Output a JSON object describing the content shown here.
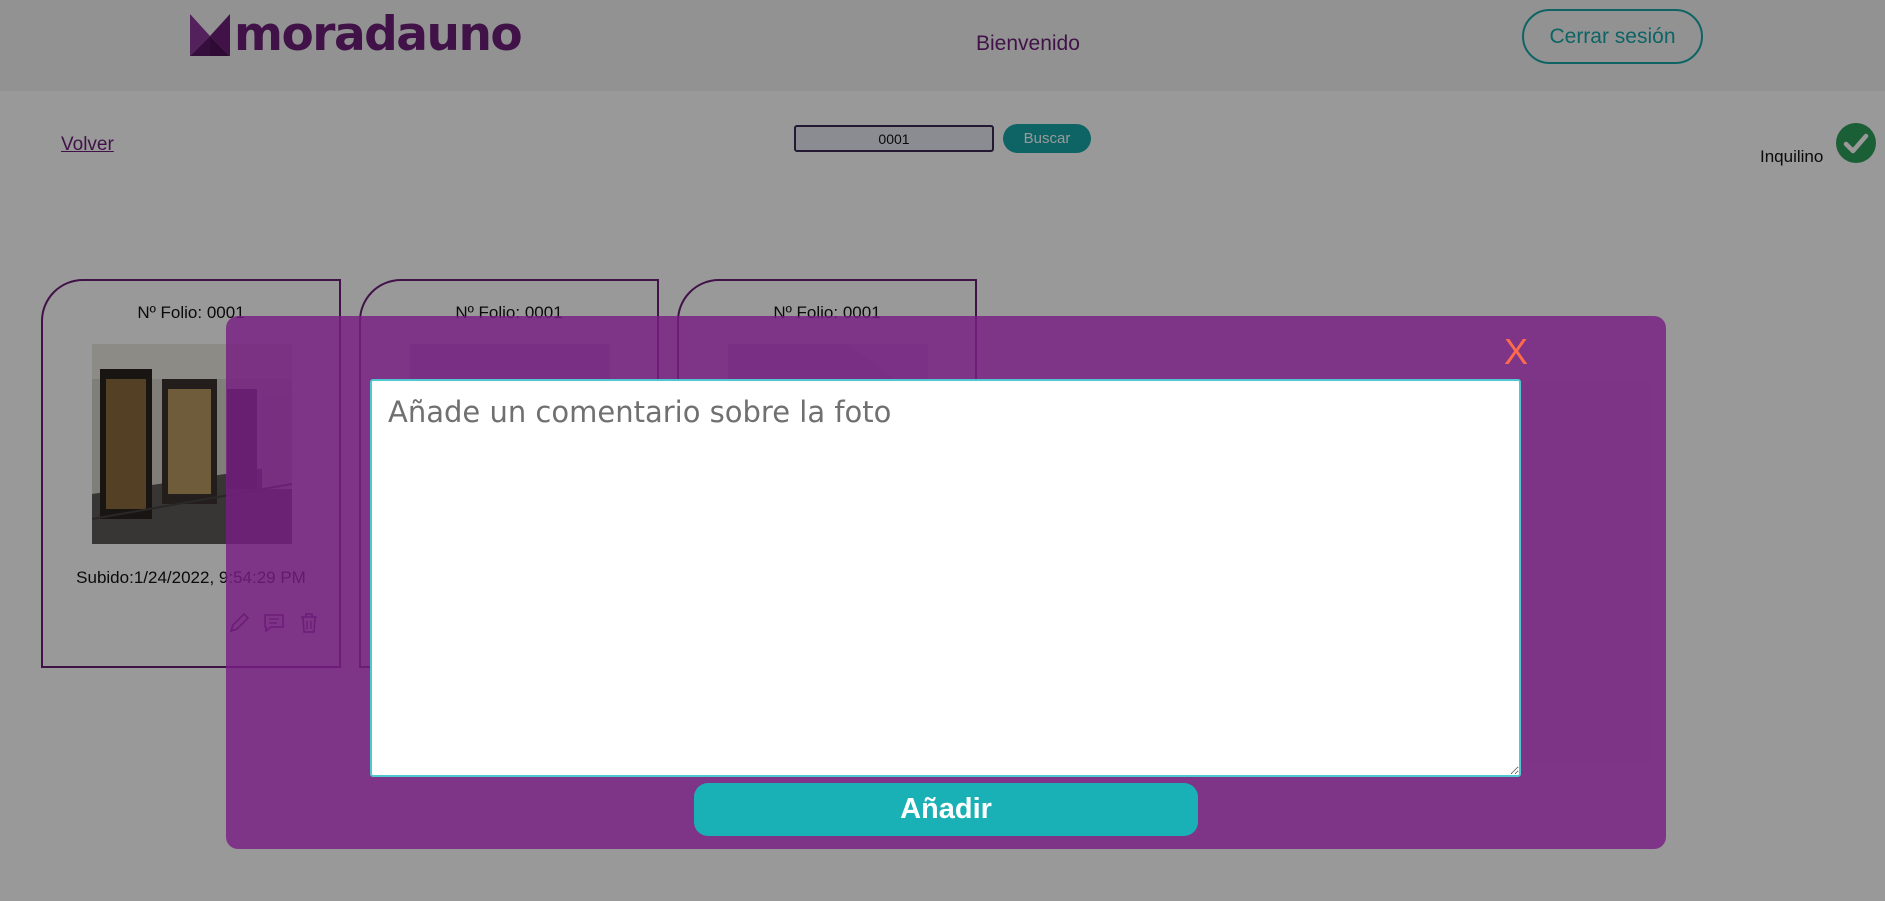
{
  "header": {
    "brand": "moradauno",
    "welcome": "Bienvenido",
    "logout_label": "Cerrar sesión"
  },
  "toolbar": {
    "back_label": "Volver",
    "search_value": "0001",
    "search_button": "Buscar",
    "role_label": "Inquilino"
  },
  "cards": [
    {
      "folio": "Nº Folio: 0001",
      "uploaded": "Subido:1/24/2022, 9:54:29 PM"
    },
    {
      "folio": "Nº Folio: 0001"
    },
    {
      "folio": "Nº Folio: 0001"
    }
  ],
  "modal": {
    "close_label": "X",
    "comment_placeholder": "Añade un comentario sobre la foto",
    "submit_label": "Añadir"
  },
  "colors": {
    "brand_purple": "#6b1f78",
    "teal": "#18a7a8",
    "modal_bg": "#7a1e82",
    "close_red": "#ff6b4a",
    "check_green": "#2e9e5b"
  }
}
